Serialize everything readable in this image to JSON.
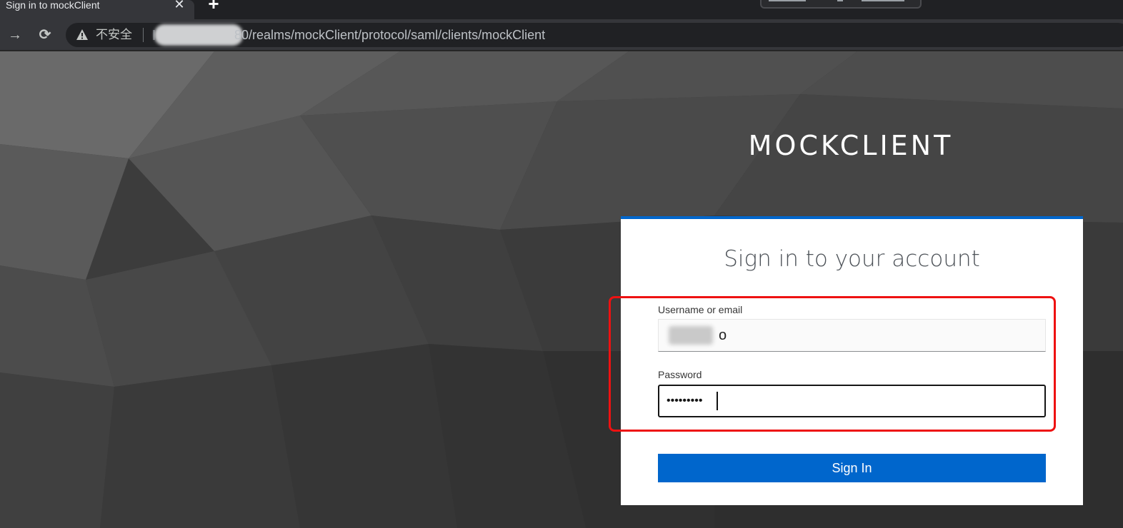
{
  "browser": {
    "tab_title": "Sign in to mockClient",
    "tab_close": "✕",
    "new_tab": "+",
    "back_icon": "→",
    "reload_icon": "⟳",
    "security_label": "不安全",
    "url_visible": "80/realms/mockClient/protocol/saml/clients/mockClient"
  },
  "page": {
    "brand": "MOCKCLIENT",
    "card_title": "Sign in to your account",
    "username_label": "Username or email",
    "username_value_visible": "o",
    "password_label": "Password",
    "password_value": "•••••••••",
    "signin_label": "Sign In",
    "accent_color": "#0066cc",
    "highlight_color": "#ee1111"
  }
}
